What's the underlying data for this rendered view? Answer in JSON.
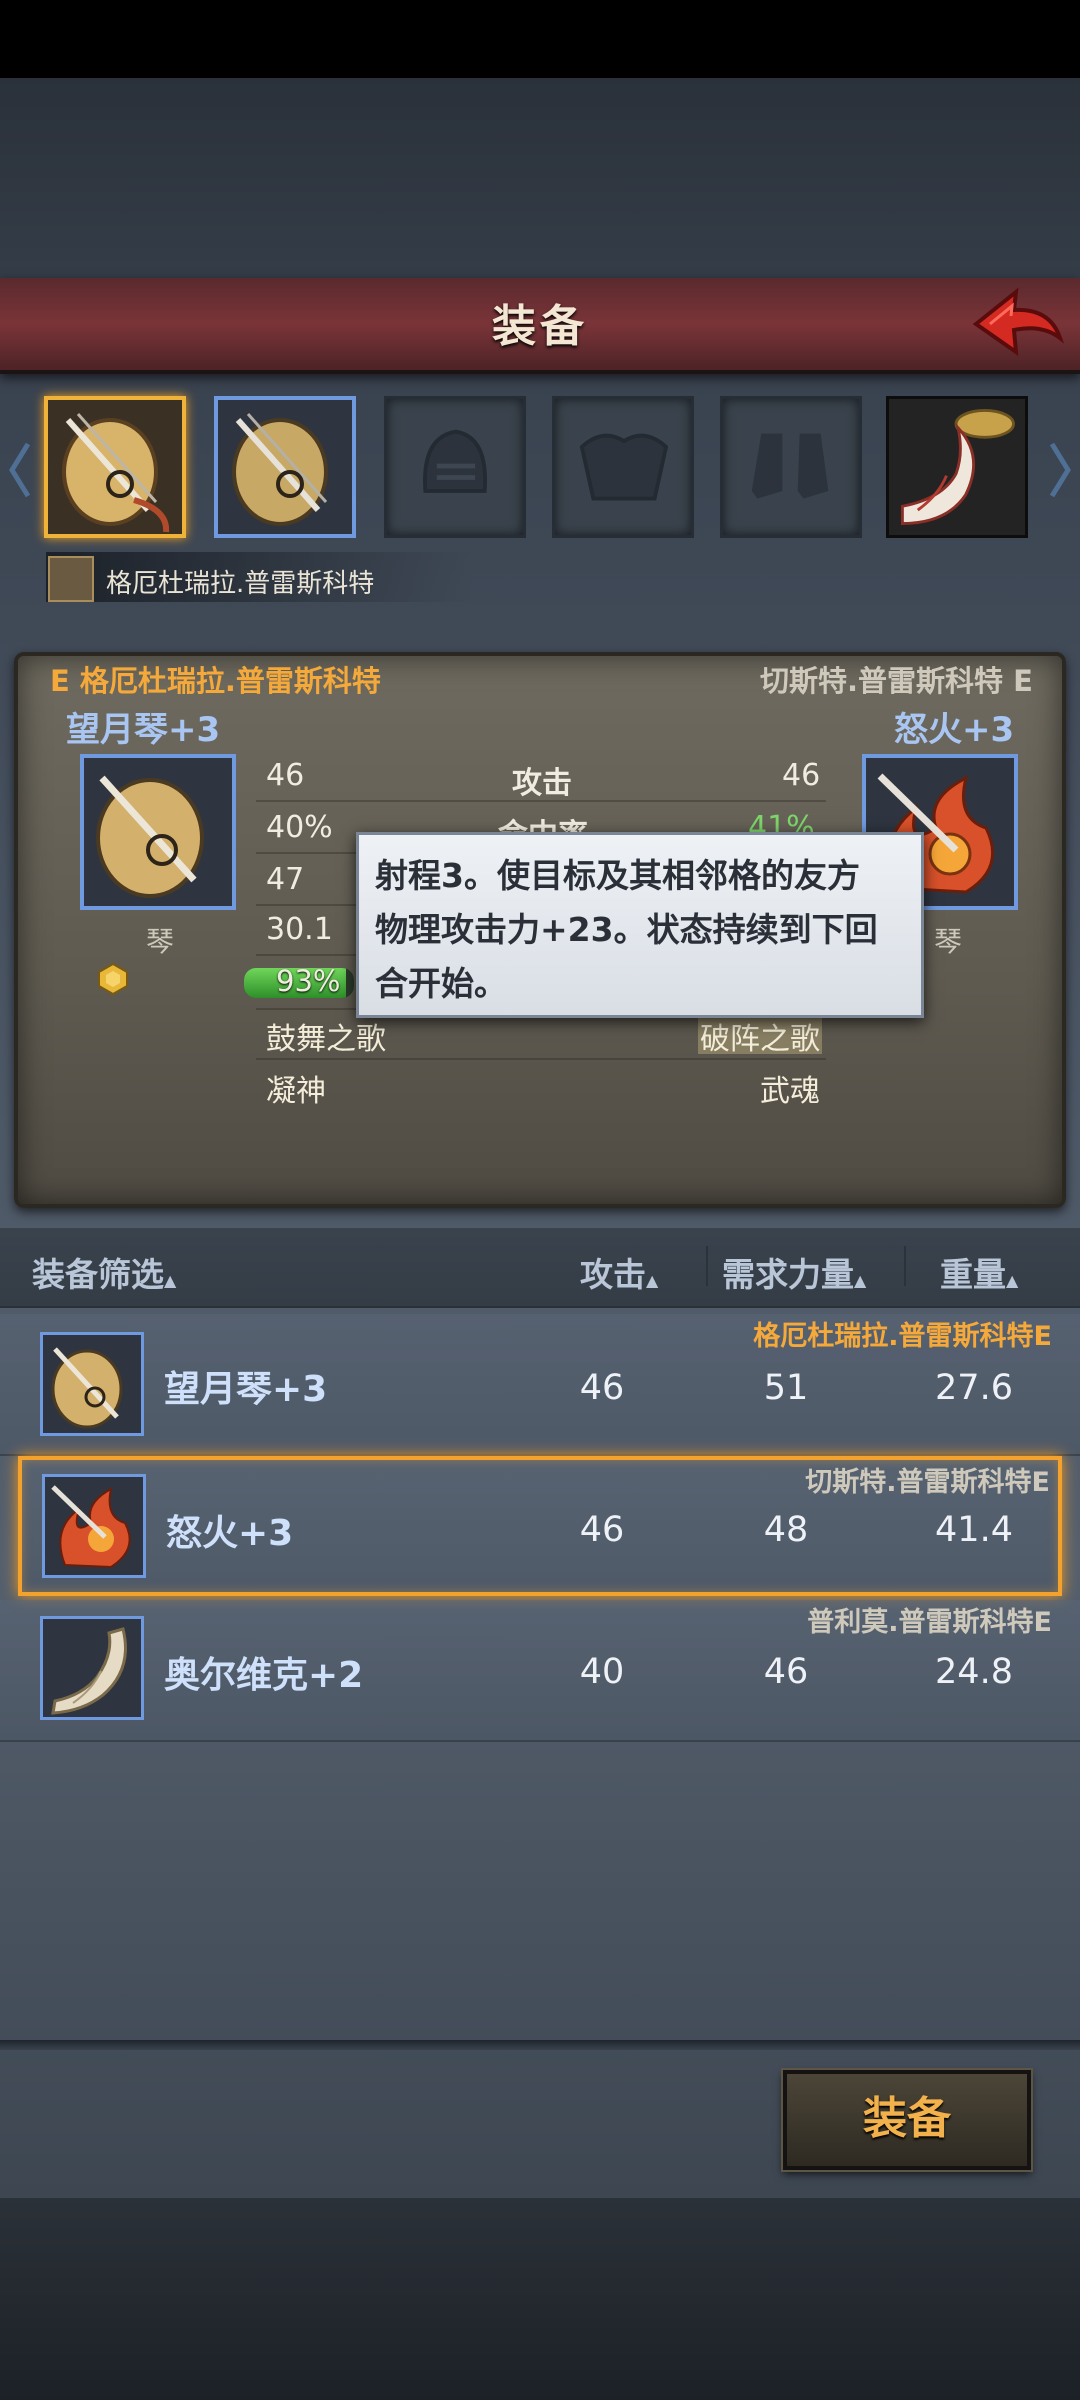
{
  "title": "装备",
  "icons": {
    "back": "back-arrow-icon",
    "left_nav": "chevron-left-icon",
    "right_nav": "chevron-right-icon",
    "gem": "gem-icon"
  },
  "owner": {
    "name": "格厄杜瑞拉.普雷斯科特"
  },
  "slots": [
    {
      "name": "lute-slot-1",
      "state": "selected"
    },
    {
      "name": "lute-slot-2",
      "state": "equipped"
    },
    {
      "name": "helmet-slot",
      "state": "empty"
    },
    {
      "name": "armor-slot",
      "state": "empty"
    },
    {
      "name": "boots-slot",
      "state": "empty"
    },
    {
      "name": "horn-slot",
      "state": "filled"
    }
  ],
  "compare": {
    "left_owner": "E 格厄杜瑞拉.普雷斯科特",
    "right_owner": "切斯特.普雷斯科特 E",
    "left_item": "望月琴+3",
    "right_item": "怒火+3",
    "left_type": "琴",
    "right_type": "琴",
    "rows": [
      {
        "left": "46",
        "label": "攻击",
        "right": "46"
      },
      {
        "left": "40%",
        "label": "命中率",
        "right": "41%"
      },
      {
        "left": "47",
        "label": "",
        "right": ""
      },
      {
        "left": "30.1",
        "label": "",
        "right": ""
      }
    ],
    "durability": "93%",
    "skills_left": [
      "鼓舞之歌",
      "凝神"
    ],
    "skills_right": [
      "破阵之歌",
      "武魂"
    ]
  },
  "tooltip": {
    "line1": "射程3。使目标及其相邻格的友方",
    "line2": "物理攻击力+23。状态持续到下回",
    "line3": "合开始。"
  },
  "list_header": {
    "filter": "装备筛选",
    "attack": "攻击",
    "strength": "需求力量",
    "weight": "重量"
  },
  "items": [
    {
      "name": "望月琴+3",
      "owner": "格厄杜瑞拉.普雷斯科特E",
      "attack": "46",
      "strength": "51",
      "weight": "27.6",
      "selected": false
    },
    {
      "name": "怒火+3",
      "owner": "切斯特.普雷斯科特E",
      "attack": "46",
      "strength": "48",
      "weight": "41.4",
      "selected": true
    },
    {
      "name": "奥尔维克+2",
      "owner": "普利莫.普雷斯科特E",
      "attack": "40",
      "strength": "46",
      "weight": "24.8",
      "selected": false
    }
  ],
  "equip_button": "装备",
  "colors": {
    "accent_orange": "#f3a22e",
    "owner_orange": "#f4a93a",
    "item_blue": "#a9c6f3",
    "title_red": "#7a3438"
  }
}
